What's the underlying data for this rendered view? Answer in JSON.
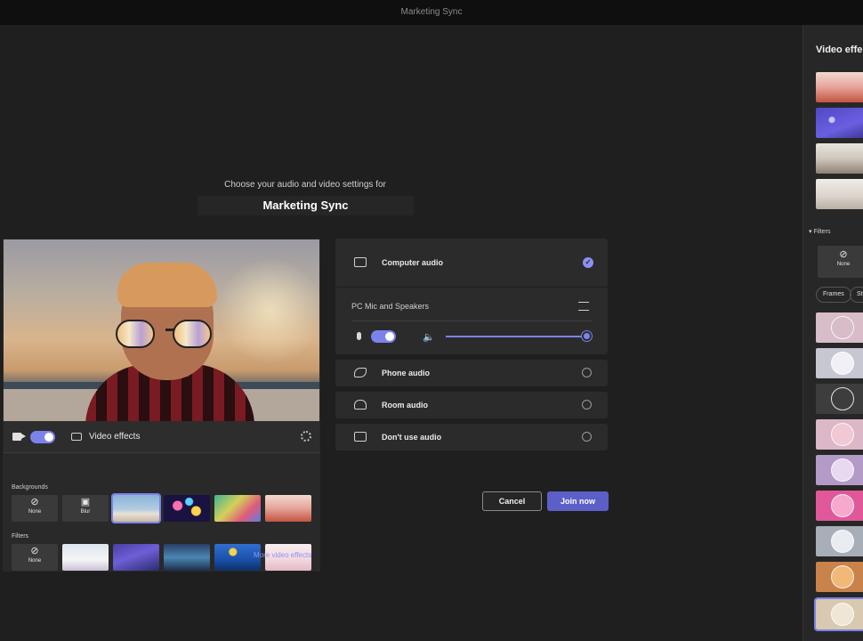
{
  "window": {
    "title": "Marketing Sync"
  },
  "prejoin": {
    "subheading": "Choose your audio and video settings for",
    "meeting_name": "Marketing Sync"
  },
  "video_controls": {
    "camera_on": true,
    "effects_label": "Video effects"
  },
  "backgrounds": {
    "section_label": "Backgrounds",
    "none_label": "None",
    "blur_label": "Blur",
    "selected_index": 2
  },
  "filters": {
    "section_label": "Filters",
    "none_label": "None"
  },
  "more_effects_link": "More video effects",
  "audio": {
    "computer_audio_label": "Computer audio",
    "computer_audio_selected": true,
    "device_label": "PC Mic and Speakers",
    "mic_on": true,
    "speaker_volume": 1.0,
    "options": [
      {
        "label": "Phone audio"
      },
      {
        "label": "Room audio"
      },
      {
        "label": "Don't use audio"
      }
    ]
  },
  "actions": {
    "cancel_label": "Cancel",
    "join_label": "Join now"
  },
  "side_panel": {
    "title": "Video effe",
    "filters_label": "Filters",
    "none_label": "None",
    "chips": [
      "Frames",
      "Sty"
    ]
  },
  "colors": {
    "accent": "#7b83eb",
    "join_button": "#5b5fc7",
    "background": "#1f1f1f"
  }
}
